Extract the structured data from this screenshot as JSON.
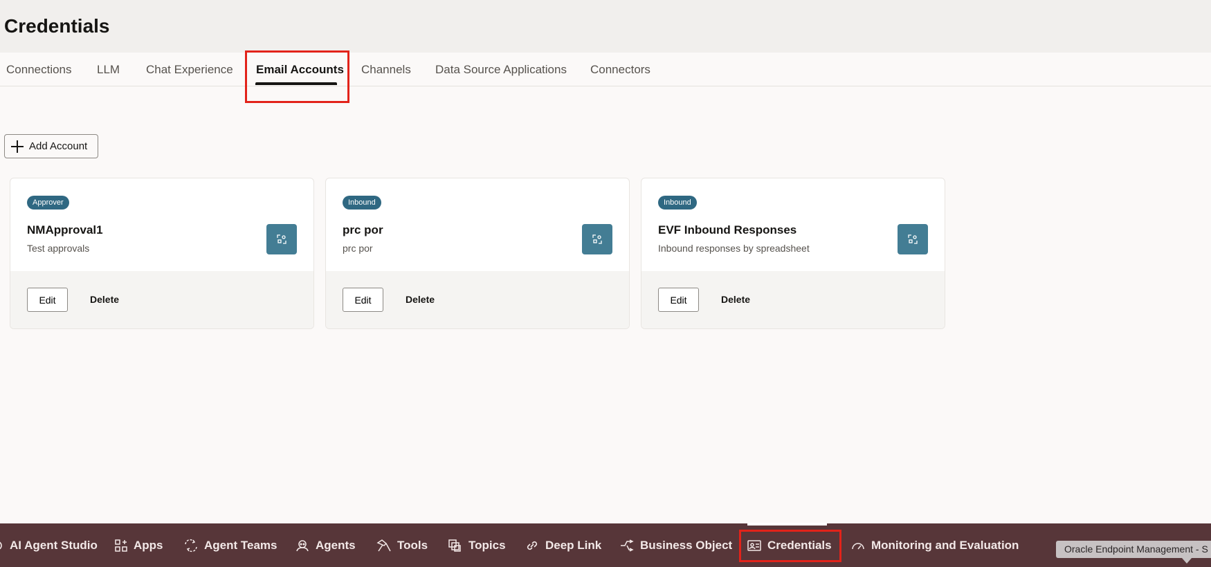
{
  "page": {
    "title": "Credentials"
  },
  "tabs": [
    {
      "label": "Connections"
    },
    {
      "label": "LLM"
    },
    {
      "label": "Chat Experience"
    },
    {
      "label": "Email Accounts",
      "active": true
    },
    {
      "label": "Channels"
    },
    {
      "label": "Data Source Applications"
    },
    {
      "label": "Connectors"
    }
  ],
  "toolbar": {
    "add_label": "Add Account"
  },
  "cards": [
    {
      "badge": "Approver",
      "title": "NMApproval1",
      "description": "Test approvals",
      "edit_label": "Edit",
      "delete_label": "Delete"
    },
    {
      "badge": "Inbound",
      "title": "prc por",
      "description": "prc por",
      "edit_label": "Edit",
      "delete_label": "Delete"
    },
    {
      "badge": "Inbound",
      "title": "EVF Inbound Responses",
      "description": "Inbound responses by spreadsheet",
      "edit_label": "Edit",
      "delete_label": "Delete"
    }
  ],
  "bottom_nav": [
    {
      "label": "AI Agent Studio",
      "icon": "studio-icon"
    },
    {
      "label": "Apps",
      "icon": "apps-icon"
    },
    {
      "label": "Agent Teams",
      "icon": "agent-teams-icon"
    },
    {
      "label": "Agents",
      "icon": "agent-icon"
    },
    {
      "label": "Tools",
      "icon": "tools-icon"
    },
    {
      "label": "Topics",
      "icon": "topics-icon"
    },
    {
      "label": "Deep Link",
      "icon": "link-icon"
    },
    {
      "label": "Business Object",
      "icon": "business-object-icon"
    },
    {
      "label": "Credentials",
      "icon": "credentials-icon",
      "active": true
    },
    {
      "label": "Monitoring and Evaluation",
      "icon": "gauge-icon"
    }
  ],
  "tooltip": {
    "text": "Oracle Endpoint Management - S"
  },
  "colors": {
    "accent": "#e2231a",
    "badge": "#2f6882",
    "nav_bg": "#573639",
    "icon_btn": "#437d94"
  }
}
